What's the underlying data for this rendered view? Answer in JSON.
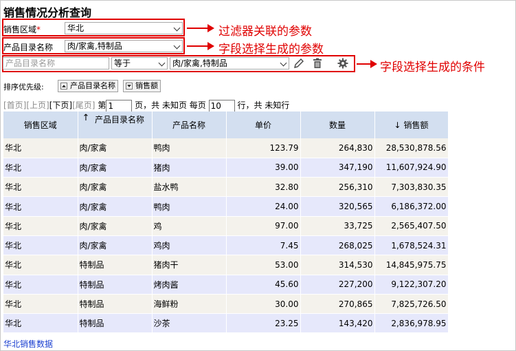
{
  "title": "销售情况分析查询",
  "filters": {
    "region_label": "销售区域",
    "region_required_mark": "*",
    "region_value": "华北",
    "category_label": "产品目录名称",
    "category_value": "肉/家禽,特制品"
  },
  "condition": {
    "field_placeholder": "产品目录名称",
    "operator_value": "等于",
    "value_value": "肉/家禽,特制品",
    "icons": [
      "pencil-icon",
      "trash-icon",
      "gear-icon"
    ]
  },
  "annotations": {
    "a1": "过滤器关联的参数",
    "a2": "字段选择生成的参数",
    "a3": "字段选择生成的条件"
  },
  "sort": {
    "label": "排序优先级:",
    "chip1": "产品目录名称",
    "chip2": "销售额"
  },
  "pager": {
    "first": "[首页]",
    "prev": "[上页]",
    "next": "[下页]",
    "last": "[尾页]",
    "page_prefix": "第",
    "page_value": "1",
    "page_suffix": "页，共 未知页 每页",
    "size_value": "10",
    "size_suffix": "行，共 未知行"
  },
  "table": {
    "headers": [
      "销售区域",
      "产品目录名称",
      "产品名称",
      "单价",
      "数量",
      "销售额"
    ],
    "sort_up_glyph": "↑",
    "sort_down_glyph": "↓",
    "rows": [
      [
        "华北",
        "肉/家禽",
        "鸭肉",
        "123.79",
        "264,830",
        "28,530,878.56"
      ],
      [
        "华北",
        "肉/家禽",
        "猪肉",
        "39.00",
        "347,190",
        "11,607,924.90"
      ],
      [
        "华北",
        "肉/家禽",
        "盐水鸭",
        "32.80",
        "256,310",
        "7,303,830.35"
      ],
      [
        "华北",
        "肉/家禽",
        "鸭肉",
        "24.00",
        "320,565",
        "6,186,372.00"
      ],
      [
        "华北",
        "肉/家禽",
        "鸡",
        "97.00",
        "33,725",
        "2,565,407.50"
      ],
      [
        "华北",
        "肉/家禽",
        "鸡肉",
        "7.45",
        "268,025",
        "1,678,524.31"
      ],
      [
        "华北",
        "特制品",
        "猪肉干",
        "53.00",
        "314,530",
        "14,845,975.75"
      ],
      [
        "华北",
        "特制品",
        "烤肉酱",
        "45.60",
        "227,200",
        "9,122,307.20"
      ],
      [
        "华北",
        "特制品",
        "海鲜粉",
        "30.00",
        "270,865",
        "7,825,726.50"
      ],
      [
        "华北",
        "特制品",
        "沙茶",
        "23.25",
        "143,420",
        "2,836,978.95"
      ]
    ]
  },
  "footer_link": "华北销售数据",
  "colors": {
    "annotation": "#e00000",
    "header_bg": "#d3dff0",
    "row_odd": "#f4f2ec",
    "row_even": "#e6e8fb",
    "link": "#1a3fd0"
  }
}
